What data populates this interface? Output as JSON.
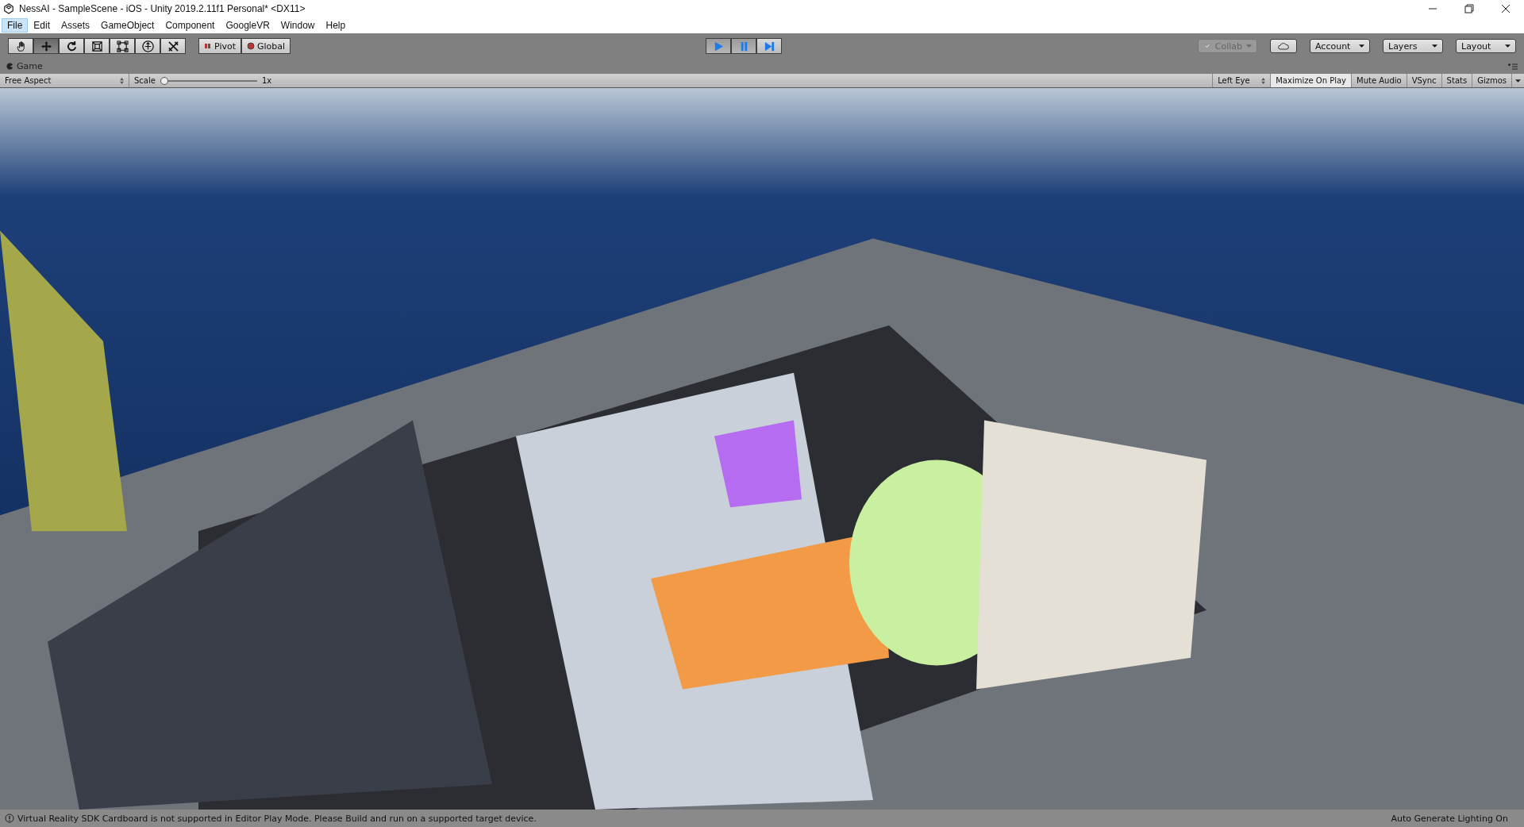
{
  "window": {
    "title": "NessAI - SampleScene - iOS - Unity 2019.2.11f1 Personal* <DX11>"
  },
  "menu": [
    {
      "label": "File",
      "selected": true
    },
    {
      "label": "Edit",
      "selected": false
    },
    {
      "label": "Assets",
      "selected": false
    },
    {
      "label": "GameObject",
      "selected": false
    },
    {
      "label": "Component",
      "selected": false
    },
    {
      "label": "GoogleVR",
      "selected": false
    },
    {
      "label": "Window",
      "selected": false
    },
    {
      "label": "Help",
      "selected": false
    }
  ],
  "tools": [
    {
      "kind": "hand",
      "selected": false
    },
    {
      "kind": "move",
      "selected": true
    },
    {
      "kind": "rotate",
      "selected": false
    },
    {
      "kind": "scale",
      "selected": false
    },
    {
      "kind": "rect",
      "selected": false
    },
    {
      "kind": "transform",
      "selected": false
    },
    {
      "kind": "custom",
      "selected": false
    }
  ],
  "handle_buttons": [
    {
      "kind": "pivot",
      "label": "Pivot"
    },
    {
      "kind": "global",
      "label": "Global"
    }
  ],
  "playback": [
    {
      "kind": "play",
      "on": true
    },
    {
      "kind": "pause",
      "on": true
    },
    {
      "kind": "step",
      "on": false
    }
  ],
  "collab": {
    "label": "Collab",
    "disabled": true
  },
  "dropdowns": [
    "Account",
    "Layers",
    "Layout"
  ],
  "game_tab": {
    "label": "Game"
  },
  "game_toolbar": {
    "aspect": "Free Aspect",
    "scale_label": "Scale",
    "scale": {
      "level": 0.0
    },
    "scale_reading": "1x",
    "eye": "Left Eye",
    "toggles": [
      {
        "label": "Maximize On Play",
        "on": true
      },
      {
        "label": "Mute Audio",
        "on": false
      },
      {
        "label": "VSync",
        "on": false
      },
      {
        "label": "Stats",
        "on": false
      }
    ],
    "gizmos": "Gizmos"
  },
  "game_view": {
    "kind": "picture"
  },
  "status_bar": {
    "message": "Virtual Reality SDK Cardboard is not supported in Editor Play Mode. Please Build and run on a supported target device.",
    "right": "Auto Generate Lighting On"
  }
}
